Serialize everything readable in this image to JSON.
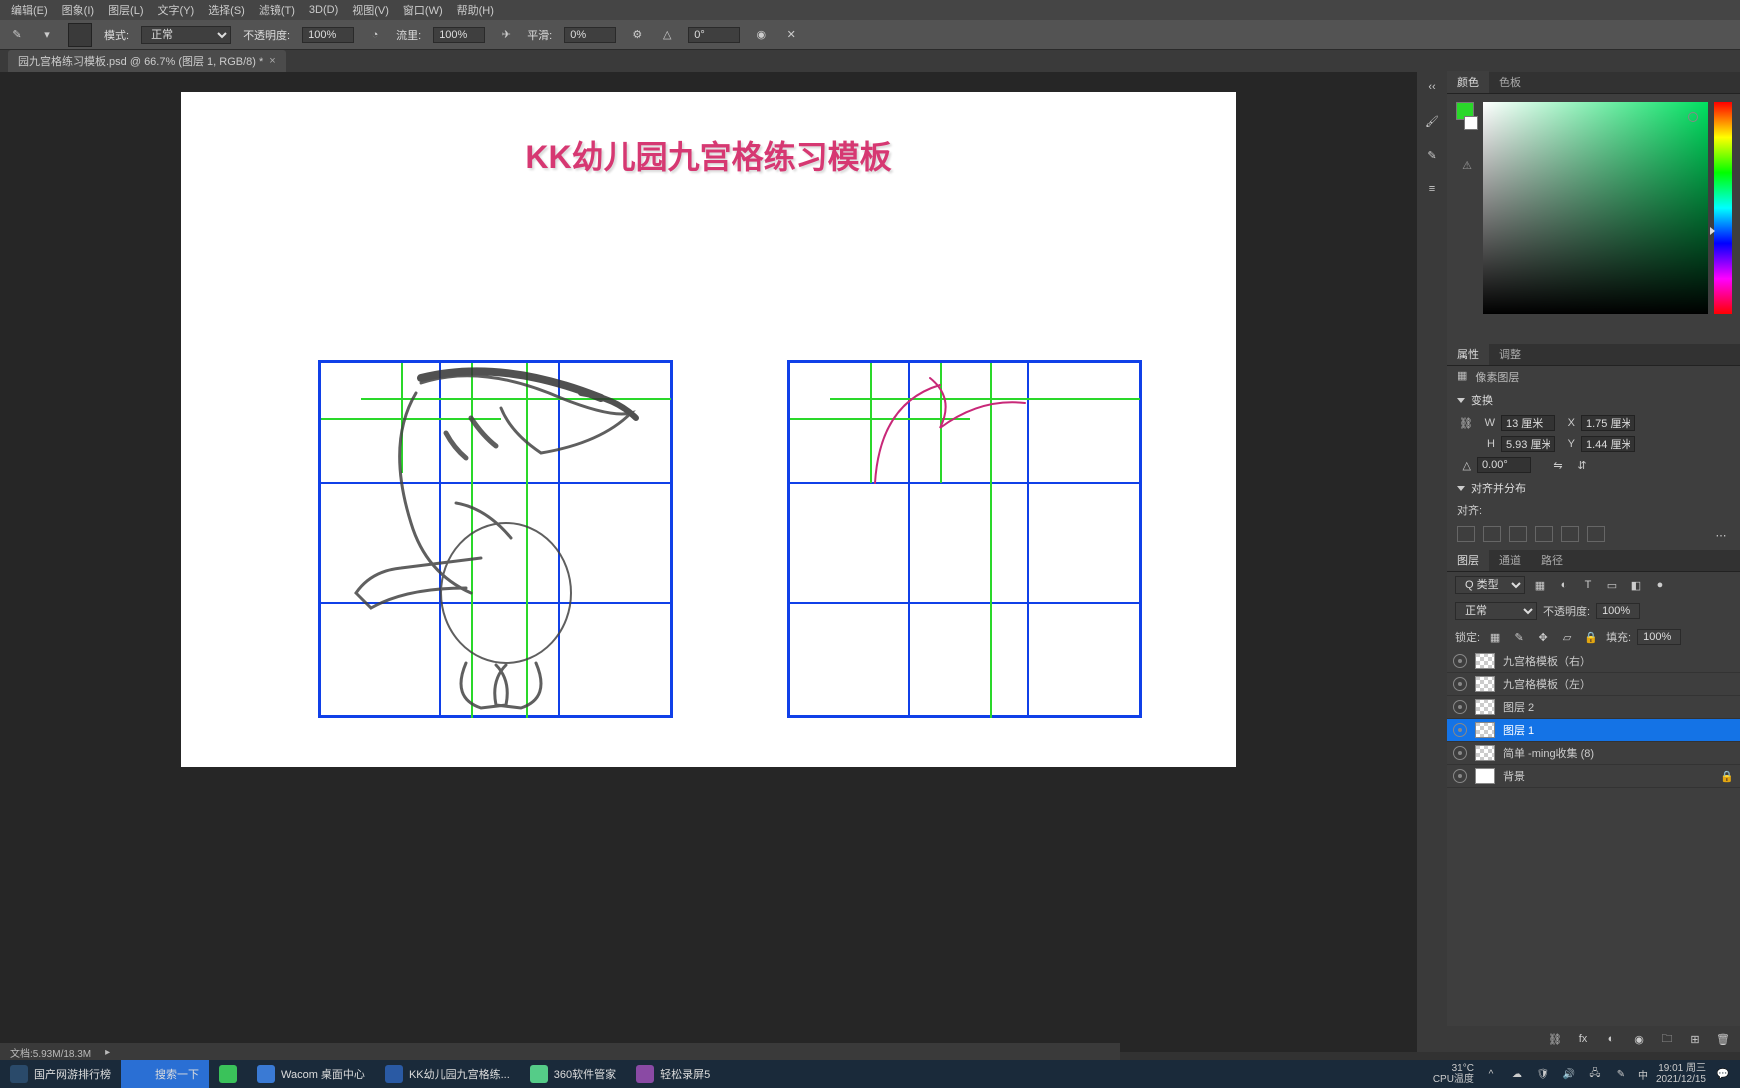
{
  "menu": {
    "edit": "编辑(E)",
    "image": "图象(I)",
    "layer": "图层(L)",
    "type": "文字(Y)",
    "select": "选择(S)",
    "filter": "滤镜(T)",
    "td": "3D(D)",
    "view": "视图(V)",
    "window": "窗口(W)",
    "help": "帮助(H)"
  },
  "options": {
    "mode_label": "模式:",
    "mode_value": "正常",
    "opacity_label": "不透明度:",
    "opacity_value": "100%",
    "flow_label": "流里:",
    "flow_value": "100%",
    "smooth_label": "平滑:",
    "smooth_value": "0%",
    "angle_value": "0°"
  },
  "doc_tab": {
    "name": "园九宫格练习模板.psd @ 66.7% (图层 1, RGB/8) *"
  },
  "canvas": {
    "title": "KK幼儿园九宫格练习模板"
  },
  "panel": {
    "color_tab": "颜色",
    "swatch_tab": "色板",
    "props_tab": "属性",
    "adjust_tab": "调整",
    "pixel_layer": "像素图层",
    "transform": "变换",
    "w_label": "W",
    "w_value": "13 厘米",
    "x_label": "X",
    "x_value": "1.75 厘米",
    "h_label": "H",
    "h_value": "5.93 厘米",
    "y_label": "Y",
    "y_value": "1.44 厘米",
    "angle_label": "△",
    "angle_value": "0.00°",
    "align_title": "对齐并分布",
    "align_label": "对齐:",
    "layers_tab": "图层",
    "channels_tab": "通道",
    "paths_tab": "路径",
    "kind_label": "Q 类型",
    "blend_mode": "正常",
    "layer_opacity_label": "不透明度:",
    "layer_opacity": "100%",
    "lock_label": "锁定:",
    "fill_label": "填充:",
    "fill_value": "100%",
    "layers": [
      {
        "name": "九宫格模板（右）"
      },
      {
        "name": "九宫格模板（左）"
      },
      {
        "name": "图层 2"
      },
      {
        "name": "图层 1"
      },
      {
        "name": "简单 -ming收集 (8)"
      },
      {
        "name": "背景"
      }
    ]
  },
  "status": {
    "doc_info": "文档:5.93M/18.3M"
  },
  "taskbar": {
    "items": [
      {
        "label": "国产网游排行榜"
      },
      {
        "label": "搜索一下"
      },
      {
        "label": ""
      },
      {
        "label": "Wacom 桌面中心"
      },
      {
        "label": "KK幼儿园九宫格练..."
      },
      {
        "label": "360软件管家"
      },
      {
        "label": "轻松录屏5"
      }
    ],
    "temp": "31°C",
    "cpu": "CPU温度",
    "ime": "中",
    "time": "19:01",
    "day": "周三",
    "date": "2021/12/15"
  },
  "colors": {
    "fg": "#2ad82a",
    "bg": "#ffffff"
  }
}
